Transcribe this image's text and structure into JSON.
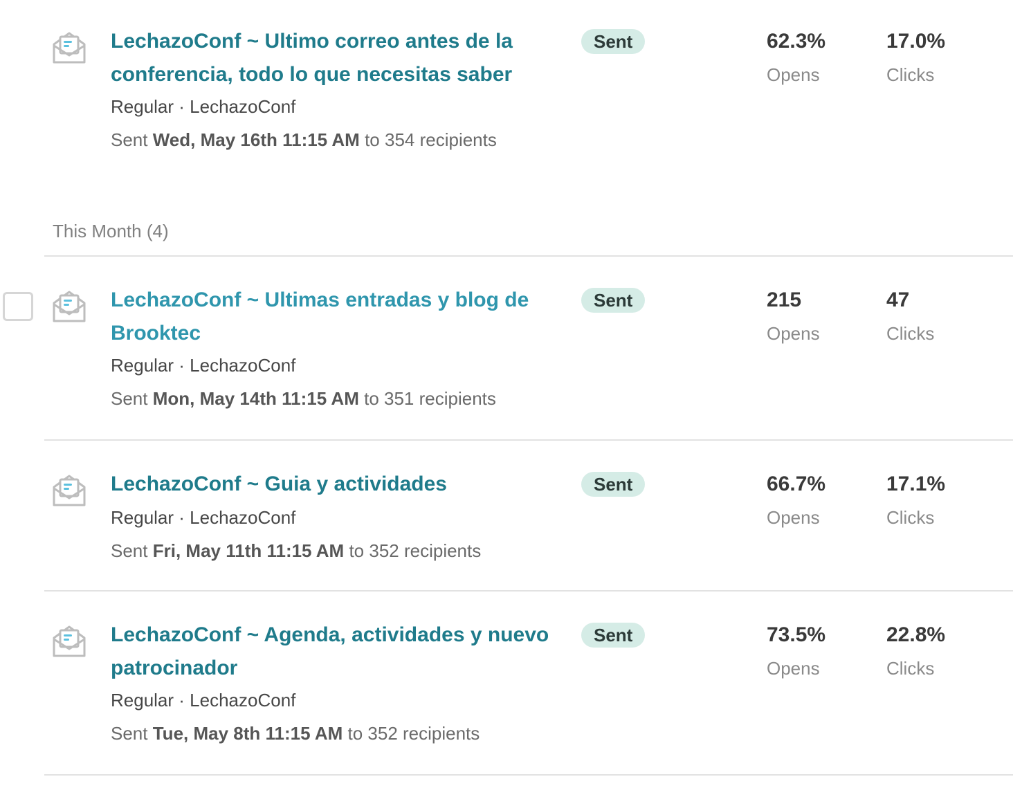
{
  "campaigns_top": [
    {
      "title": "LechazoConf ~ Ultimo correo antes de la conferencia, todo lo que necesitas saber",
      "type_list": "Regular · LechazoConf",
      "sent_prefix": "Sent",
      "sent_date": "Wed, May 16th 11:15 AM",
      "sent_suffix": "to 354 recipients",
      "status": "Sent",
      "opens_value": "62.3%",
      "opens_label": "Opens",
      "clicks_value": "17.0%",
      "clicks_label": "Clicks",
      "icon": "envelope-open-icon"
    }
  ],
  "section": {
    "label": "This Month (4)"
  },
  "campaigns": [
    {
      "title": "LechazoConf ~ Ultimas entradas y blog de Brooktec",
      "type_list": "Regular · LechazoConf",
      "sent_prefix": "Sent",
      "sent_date": "Mon, May 14th 11:15 AM",
      "sent_suffix": "to 351 recipients",
      "status": "Sent",
      "opens_value": "215",
      "opens_label": "Opens",
      "clicks_value": "47",
      "clicks_label": "Clicks",
      "icon": "envelope-open-icon"
    },
    {
      "title": "LechazoConf ~ Guia y actividades",
      "type_list": "Regular · LechazoConf",
      "sent_prefix": "Sent",
      "sent_date": "Fri, May 11th 11:15 AM",
      "sent_suffix": "to 352 recipients",
      "status": "Sent",
      "opens_value": "66.7%",
      "opens_label": "Opens",
      "clicks_value": "17.1%",
      "clicks_label": "Clicks",
      "icon": "envelope-open-icon"
    },
    {
      "title": "LechazoConf ~ Agenda, actividades y nuevo patrocinador",
      "type_list": "Regular · LechazoConf",
      "sent_prefix": "Sent",
      "sent_date": "Tue, May 8th 11:15 AM",
      "sent_suffix": "to 352 recipients",
      "status": "Sent",
      "opens_value": "73.5%",
      "opens_label": "Opens",
      "clicks_value": "22.8%",
      "clicks_label": "Clicks",
      "icon": "envelope-open-icon"
    }
  ],
  "colors": {
    "title": "#1f7b8b",
    "title_hover": "#2f96ad",
    "badge_bg": "#d5ece6",
    "divider": "#e2e2e2"
  }
}
